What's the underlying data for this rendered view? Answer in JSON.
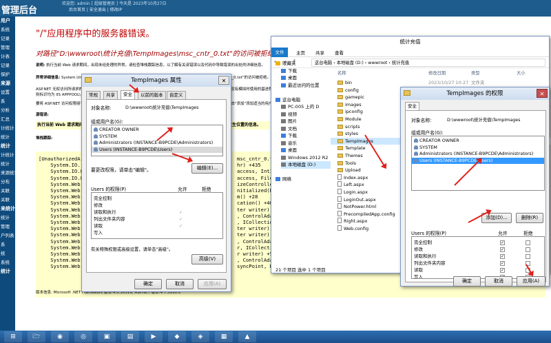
{
  "banner": {
    "title": "管理后台",
    "top_line": "欢迎您: admin  [ 超级管理员 ]  今天是 2023年10月27日",
    "links": "后台首页 | 安全退出 | 修改IP"
  },
  "sidebar": [
    "用户",
    "系统",
    "记录",
    "管理",
    "计表",
    "记录",
    "保护",
    "来源",
    "设置",
    "系",
    "分析",
    "汇总",
    "计统计",
    "统计",
    "统计",
    "计统计",
    "统计",
    "来源统计",
    "分布",
    "关联",
    "关联",
    "来统计",
    "统计",
    "管理",
    "户列表",
    "系",
    "统",
    "系统",
    "统计"
  ],
  "error": {
    "title": "\"/\"应用程序中的服务器错误。",
    "subtitle": "对路径\"D:\\wwwroot\\统计充值\\TempImages\\msc_cntr_0.txt\"的访问被拒绝。",
    "desc_label": "说明:",
    "desc": "执行当前 Web 请求期间，出现未经处理的异常。请检查堆栈跟踪信息，以了解有关该错误以及代码中导致错误的出处的详细信息。",
    "exc_label": "异常详细信息:",
    "exc": "System.UnauthorizedAccessException: 对路径\"D:\\wwwroot\\统计充值\\TempImages\\msc_cntr_0.txt\"的访问被拒绝。",
    "aspnet1": "ASP.NET 无权访问所请求的资源。请考虑对 ASP.NET 请求标识授予访问此资源的权限。ASP.NET 有一个在应用程序没有模拟时使用的基进程标识(通常，",
    "aspnet2": "则标识均为 IIS APPPOOL\\{AppPoolName})。",
    "aspnet3": "要将 ASP.NET 访问权限授予某个文件，请在资源管理器中右键单击该文件，选择\"属性\"，然后选择\"安全\"选项卡。单击\"添加\"添加适当的用户或组。",
    "source_label": "源错误:",
    "yellow": "执行当前 Web 请求期间生成了未经处理的异常。可以使用下面的异常堆栈跟踪信息确定有关异常原因和发生位置的信息。",
    "stack_label": "堆栈跟踪:",
    "stack_left": "[UnauthorizedA\n    System.IO.\n    System.IO.F\n    System.IO.F\n    System.Web.\n    System.Web.\n    System.Web.\n    System.Web.\n    System.Web.\n    System.Web.\n    System.Web.\n    System.Web.\n    System.Web.\n    System.Web.\n    System.Web.\n    System.Web.\n    System.Web.\n    System.Web.",
    "stack_right": "msc_cntr_0.tx\nhr) +435\naccess, Int32\naccess, File\nizeController\nnitialized(Bo\nm() +28\ncation() +40\nter writer) +\n, ControlAdap\n, ICollection\nter writer) +116\nter writer)\n, ControlAdap\nr, ICollectio\nr writer) +53\n, ControlAdap\nsyncPoint, B",
    "version": "版本信息: Microsoft .NET Framework 版本:4.0.30319; ASP.NET 版本:4.7.3930.0"
  },
  "props_dialog": {
    "title": "TempImages 属性",
    "tabs": [
      "常规",
      "共享",
      "安全",
      "以前的版本",
      "自定义"
    ],
    "object_label": "对象名称:",
    "object_value": "D:\\wwwroot\\统计充值\\TempImages",
    "group_label": "组或用户名(G):",
    "users": [
      "CREATOR OWNER",
      "SYSTEM",
      "Administrators (INSTANCE-B9PCDE\\Administrators)",
      "Users (INSTANCE-B9PCDE\\Users)"
    ],
    "change_hint": "要更改权限，请单击\"编辑\"。",
    "edit_button": "编辑(E)...",
    "perm_label": "Users 的权限(P)",
    "allow": "允许",
    "deny": "拒绝",
    "perms": [
      "完全控制",
      "修改",
      "读取和执行",
      "列出文件夹内容",
      "读取",
      "写入"
    ],
    "perm_allow": [
      false,
      false,
      true,
      true,
      true,
      false
    ],
    "special_hint": "有关特殊权限或高级设置，请单击\"高级\"。",
    "adv_button": "高级(V)",
    "ok": "确定",
    "cancel": "取消",
    "apply": "应用(A)"
  },
  "explorer": {
    "title": "统计充值",
    "menu": [
      "文件",
      "主页",
      "共享",
      "查看"
    ],
    "address": "这台电脑  ›  本地磁盘 (D:)  ›  wwwroot  ›  统计充值",
    "nav": [
      "收藏夹",
      "下载",
      "桌面",
      "最近访问的位置",
      "",
      "这台电脑",
      "PC-005 上的 D",
      "视频",
      "图片",
      "文档",
      "下载",
      "音乐",
      "桌面",
      "Windows 2012 R2",
      "本地磁盘 (D:)",
      "",
      "网络"
    ],
    "col_name": "名称",
    "col_date": "修改日期",
    "col_type": "类型",
    "col_size": "大小",
    "first_date": "2023/10/27 10:27",
    "first_type": "文件夹",
    "files": [
      "bin",
      "config",
      "gamepic",
      "images",
      "ipconfig",
      "Module",
      "scripts",
      "styles",
      "TempImages",
      "Template",
      "Themes",
      "Tools",
      "Upload",
      "Index.aspx",
      "Left.aspx",
      "Login.aspx",
      "LoginOut.aspx",
      "NotPower.html",
      "PrecompiledApp.config",
      "Right.aspx",
      "Web.config"
    ],
    "folder_count": 13,
    "selected_index": 8,
    "status": "21 个项目    选中 1 个项目"
  },
  "perm_dialog": {
    "title": "TempImages 的权限",
    "tab": "安全",
    "object_label": "对象名称:",
    "object_value": "D:\\wwwroot\\统计充值\\TempImages",
    "group_label": "组或用户名(G):",
    "users": [
      "CREATOR OWNER",
      "SYSTEM",
      "Administrators (INSTANCE-B9PCDE\\Administrators)",
      "Users (INSTANCE-B9PCDE\\Users)"
    ],
    "selected_index": 3,
    "add_button": "添加(D)...",
    "remove_button": "删除(R)",
    "perm_label": "Users 的权限(P)",
    "allow": "允许",
    "deny": "拒绝",
    "perms": [
      "完全控制",
      "修改",
      "读取和执行",
      "列出文件夹内容",
      "读取",
      "写入"
    ],
    "ok": "确定",
    "cancel": "取消",
    "apply": "应用(A)"
  },
  "taskbar": [
    "⊞",
    "🗁",
    "◉",
    "◎",
    "▣",
    "▤",
    "▶",
    "◆",
    "◈",
    "▦",
    "▲"
  ]
}
